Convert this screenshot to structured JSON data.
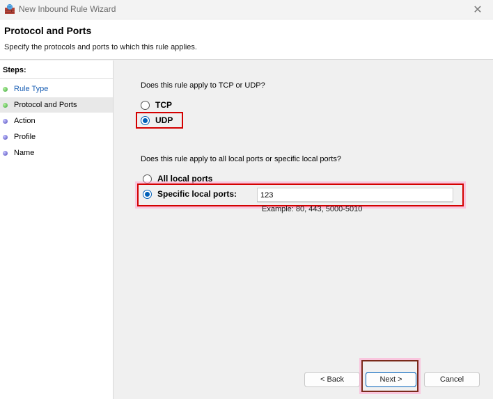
{
  "window": {
    "title": "New Inbound Rule Wizard"
  },
  "header": {
    "title": "Protocol and Ports",
    "subtitle": "Specify the protocols and ports to which this rule applies."
  },
  "steps": {
    "title": "Steps:",
    "items": [
      {
        "label": "Rule Type",
        "state": "done",
        "link": true
      },
      {
        "label": "Protocol and Ports",
        "state": "done",
        "current": true
      },
      {
        "label": "Action",
        "state": "todo"
      },
      {
        "label": "Profile",
        "state": "todo"
      },
      {
        "label": "Name",
        "state": "todo"
      }
    ]
  },
  "protocol": {
    "question": "Does this rule apply to TCP or UDP?",
    "options": [
      {
        "label": "TCP",
        "checked": false
      },
      {
        "label": "UDP",
        "checked": true
      }
    ]
  },
  "ports": {
    "question": "Does this rule apply to all local ports or specific local ports?",
    "options": [
      {
        "label": "All local ports",
        "checked": false
      },
      {
        "label": "Specific local ports:",
        "checked": true
      }
    ],
    "value": "123",
    "example": "Example: 80, 443, 5000-5010"
  },
  "buttons": {
    "back": "< Back",
    "next": "Next >",
    "cancel": "Cancel"
  },
  "icons": {
    "app": "firewall-icon",
    "close": "close-icon"
  },
  "colors": {
    "accent": "#005fb8",
    "highlight_red": "#d40000",
    "highlight_brown": "#7a2a1a"
  }
}
